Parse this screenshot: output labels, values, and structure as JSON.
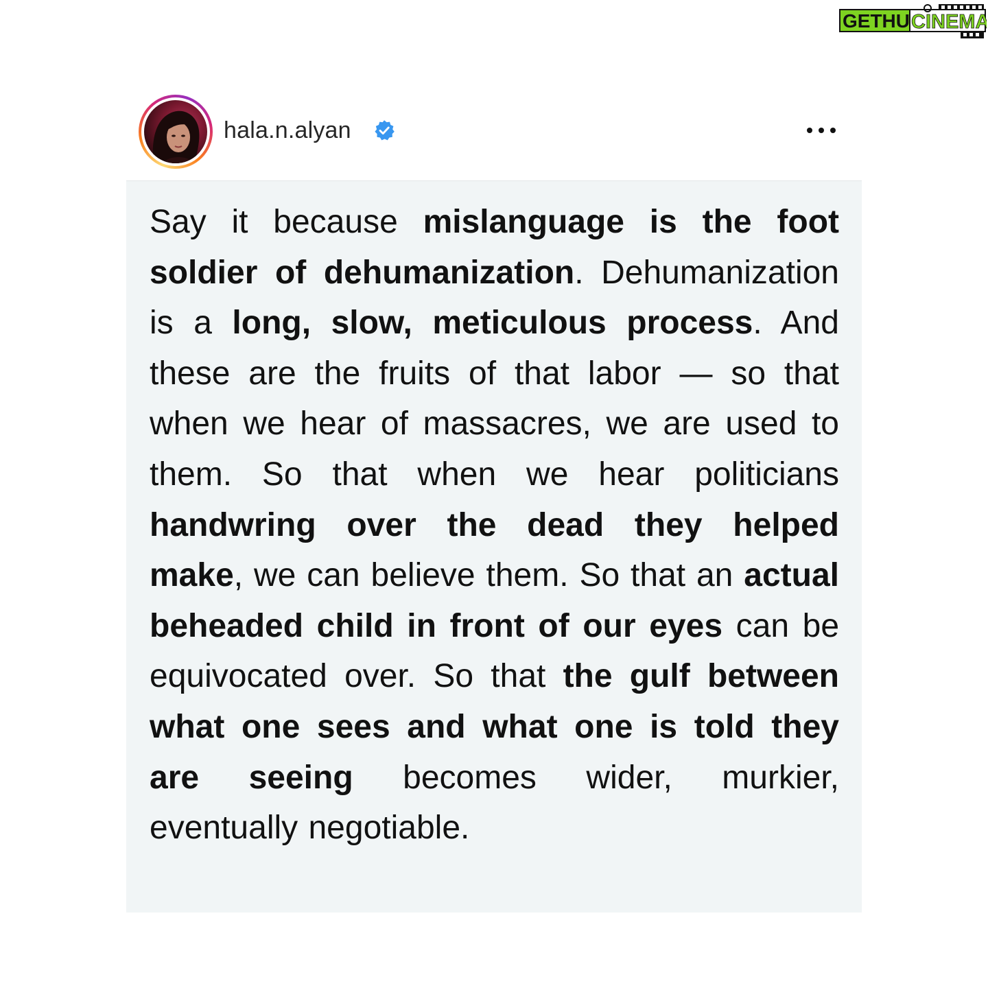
{
  "watermark": {
    "part1": "GETHU",
    "part2": "CINEMA"
  },
  "post": {
    "username": "hala.n.alyan",
    "verified": true,
    "avatar_icon": "profile-photo",
    "menu_icon": "more-horizontal-icon",
    "segments": [
      {
        "text": "Say it because ",
        "bold": false
      },
      {
        "text": "mislanguage is the foot soldier of dehumanization",
        "bold": true
      },
      {
        "text": ". Dehumanization is a ",
        "bold": false
      },
      {
        "text": "long, slow, meticulous process",
        "bold": true
      },
      {
        "text": ". And these are the fruits of that labor — so that when we hear of massacres, we are used to them. So that when we hear politicians ",
        "bold": false
      },
      {
        "text": "handwring over the dead they helped make",
        "bold": true
      },
      {
        "text": ", we can believe them. So that an ",
        "bold": false
      },
      {
        "text": "actual beheaded child in front of our eyes",
        "bold": true
      },
      {
        "text": " can be equivocated over. So that ",
        "bold": false
      },
      {
        "text": "the gulf between what one sees and what one is told they are seeing",
        "bold": true
      },
      {
        "text": " becomes wider, murkier, eventually negotiable.",
        "bold": false
      }
    ]
  },
  "colors": {
    "card_background": "#f1f5f6",
    "verified_blue": "#3897f0",
    "watermark_green": "#7ed321",
    "text": "#111111"
  }
}
